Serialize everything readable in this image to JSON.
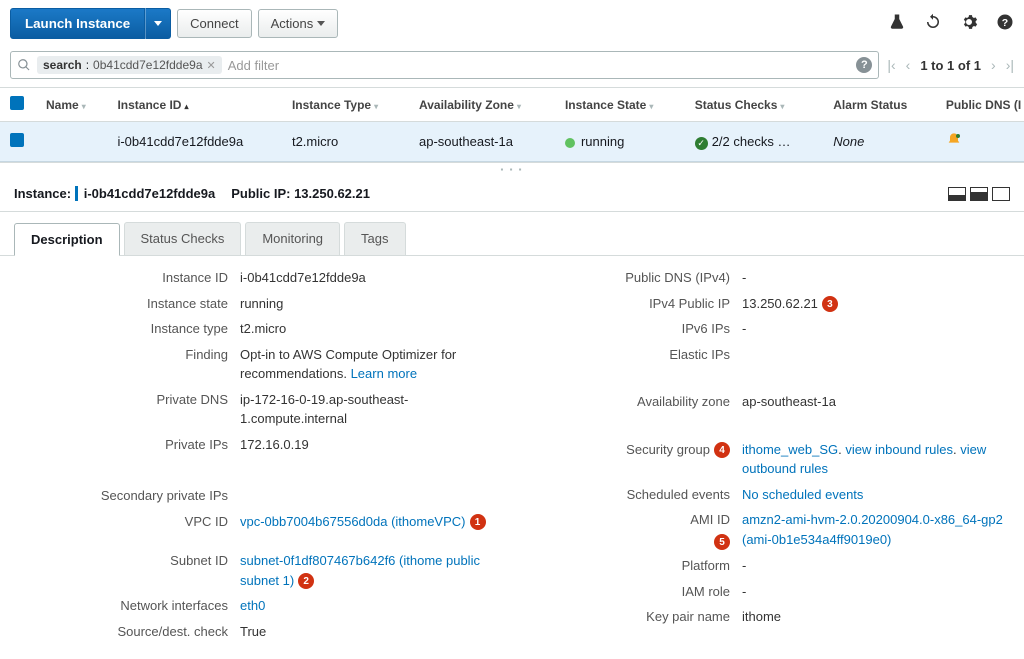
{
  "toolbar": {
    "launch": "Launch Instance",
    "connect": "Connect",
    "actions": "Actions"
  },
  "filter": {
    "chip_label": "search",
    "chip_value": "0b41cdd7e12fdde9a",
    "add_filter": "Add filter"
  },
  "pager": {
    "text": "1 to 1 of 1"
  },
  "columns": {
    "name": "Name",
    "instance_id": "Instance ID",
    "instance_type": "Instance Type",
    "az": "Availability Zone",
    "state": "Instance State",
    "checks": "Status Checks",
    "alarm": "Alarm Status",
    "public_dns": "Public DNS (I"
  },
  "row": {
    "name": "",
    "instance_id": "i-0b41cdd7e12fdde9a",
    "instance_type": "t2.micro",
    "az": "ap-southeast-1a",
    "state": "running",
    "checks": "2/2 checks …",
    "alarm": "None"
  },
  "detail_header": {
    "instance_label": "Instance:",
    "instance_id": "i-0b41cdd7e12fdde9a",
    "public_ip_label": "Public IP:",
    "public_ip": "13.250.62.21"
  },
  "tabs": {
    "description": "Description",
    "status_checks": "Status Checks",
    "monitoring": "Monitoring",
    "tags": "Tags"
  },
  "left": {
    "instance_id": {
      "k": "Instance ID",
      "v": "i-0b41cdd7e12fdde9a"
    },
    "instance_state": {
      "k": "Instance state",
      "v": "running"
    },
    "instance_type": {
      "k": "Instance type",
      "v": "t2.micro"
    },
    "finding": {
      "k": "Finding",
      "v1": "Opt-in to AWS Compute Optimizer for recommendations.",
      "v2": "Learn more"
    },
    "private_dns": {
      "k": "Private DNS",
      "v": "ip-172-16-0-19.ap-southeast-1.compute.internal"
    },
    "private_ips": {
      "k": "Private IPs",
      "v": "172.16.0.19"
    },
    "secondary": {
      "k": "Secondary private IPs",
      "v": ""
    },
    "vpc_id": {
      "k": "VPC ID",
      "v1": "vpc-0bb7004b67556d0da (ithomeVPC)",
      "badge": "1"
    },
    "subnet_id": {
      "k": "Subnet ID",
      "v1": "subnet-0f1df807467b642f6 (ithome public subnet 1)",
      "badge": "2"
    },
    "net_if": {
      "k": "Network interfaces",
      "v": "eth0"
    },
    "srcdest": {
      "k": "Source/dest. check",
      "v": "True"
    }
  },
  "right": {
    "public_dns": {
      "k": "Public DNS (IPv4)",
      "v": "-"
    },
    "ipv4_public": {
      "k": "IPv4 Public IP",
      "v": "13.250.62.21",
      "badge": "3"
    },
    "ipv6": {
      "k": "IPv6 IPs",
      "v": "-"
    },
    "elastic": {
      "k": "Elastic IPs",
      "v": ""
    },
    "az": {
      "k": "Availability zone",
      "v": "ap-southeast-1a"
    },
    "sg": {
      "k": "Security group",
      "v1": "ithome_web_SG",
      "v2": "view inbound rules",
      "v3": "view outbound rules",
      "badge": "4",
      "dot": ". "
    },
    "events": {
      "k": "Scheduled events",
      "v": "No scheduled events"
    },
    "ami": {
      "k": "AMI ID",
      "v": "amzn2-ami-hvm-2.0.20200904.0-x86_64-gp2 (ami-0b1e534a4ff9019e0)",
      "badge": "5"
    },
    "platform": {
      "k": "Platform",
      "v": "-"
    },
    "iam": {
      "k": "IAM role",
      "v": "-"
    },
    "keypair": {
      "k": "Key pair name",
      "v": "ithome"
    }
  }
}
